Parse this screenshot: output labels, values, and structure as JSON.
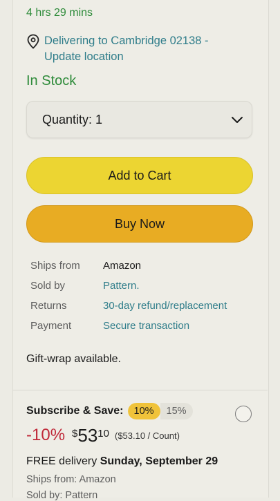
{
  "delivery": {
    "time_remaining": "4 hrs 29 mins",
    "location_line1": "Delivering to Cambridge 02138 -",
    "location_line2": "Update location",
    "icon": "location-pin-icon"
  },
  "stock_status": "In Stock",
  "quantity": {
    "label": "Quantity: 1",
    "icon": "chevron-down-icon"
  },
  "buttons": {
    "add_to_cart": "Add to Cart",
    "buy_now": "Buy Now"
  },
  "details": [
    {
      "label": "Ships from",
      "value": "Amazon"
    },
    {
      "label": "Sold by",
      "value": "Pattern."
    },
    {
      "label": "Returns",
      "value": "30-day refund/replacement"
    },
    {
      "label": "Payment",
      "value": "Secure transaction"
    }
  ],
  "gift_wrap": "Gift-wrap available.",
  "subscribe": {
    "label": "Subscribe & Save:",
    "option_selected": "10%",
    "option_other": "15%",
    "discount": "-10%",
    "price_symbol": "$",
    "price_whole": "53",
    "price_fraction": "10",
    "unit_price": "($53.10 / Count)",
    "delivery_prefix": "FREE delivery ",
    "delivery_date": "Sunday, September 29",
    "ships_from": "Ships from: Amazon",
    "sold_by": "Sold by: Pattern"
  },
  "colors": {
    "in_stock": "#2e8b3a",
    "link": "#2f7d8a",
    "add_to_cart": "#ecd532",
    "buy_now": "#e8ac23",
    "discount": "#c02a3a"
  }
}
